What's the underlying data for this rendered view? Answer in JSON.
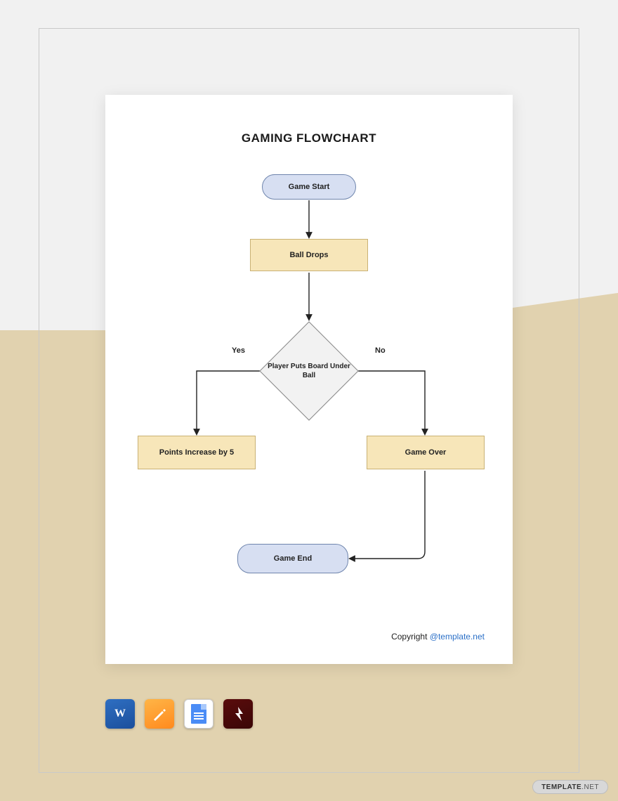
{
  "title": "GAMING FLOWCHART",
  "nodes": {
    "start": "Game Start",
    "drops": "Ball Drops",
    "decision": "Player Puts Board Under Ball",
    "yes_result": "Points Increase by 5",
    "no_result": "Game Over",
    "end": "Game End"
  },
  "edges": {
    "yes_label": "Yes",
    "no_label": "No"
  },
  "footer": {
    "copyright_prefix": "Copyright ",
    "copyright_link": "@template.net"
  },
  "app_icons": {
    "word": "Microsoft Word",
    "pages": "Apple Pages",
    "docs": "Google Docs",
    "pdf": "Adobe PDF"
  },
  "watermark": {
    "brand": "TEMPLATE",
    "suffix": ".NET"
  }
}
